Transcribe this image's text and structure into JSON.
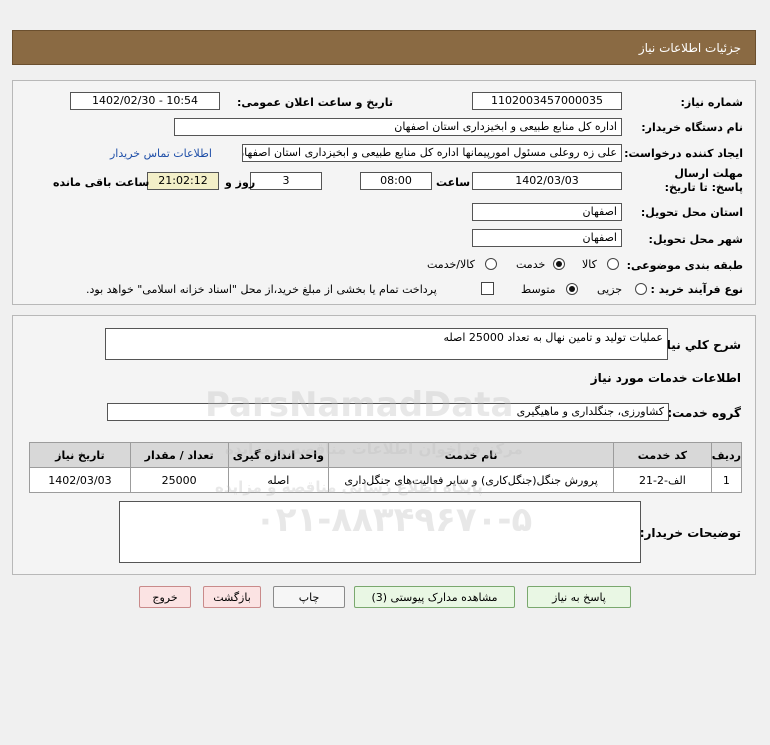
{
  "header": {
    "title": "جزئیات اطلاعات نیاز"
  },
  "labels": {
    "need_number": "شماره نیاز:",
    "announce_datetime": "تاریخ و ساعت اعلان عمومی:",
    "buyer_org": "نام دستگاه خریدار:",
    "requester": "ایجاد کننده درخواست:",
    "deadline": "مهلت ارسال پاسخ: تا تاریخ:",
    "time": "ساعت",
    "day_and": "روز و",
    "remaining": "ساعت باقی مانده",
    "province": "استان محل تحویل:",
    "city": "شهر محل تحویل:",
    "category": "طبقه بندی موضوعی:",
    "process_type": "نوع فرآیند خرید :",
    "general_desc": "شرح کلي نياز:",
    "services_info": "اطلاعات خدمات مورد نیاز",
    "service_group": "گروه خدمت:",
    "buyer_notes": "توضیحات خریدار:"
  },
  "values": {
    "need_number": "1102003457000035",
    "announce_datetime": "1402/02/30 - 10:54",
    "buyer_org": "اداره کل منابع طبیعی و ابخیزداری استان اصفهان",
    "requester": "علی زه روعلی مسئول امورپیمانها اداره کل منابع طبیعی و ابخیزداری استان اصفهان",
    "contact_link": "اطلاعات تماس خریدار",
    "deadline_date": "1402/03/03",
    "deadline_time": "08:00",
    "days": "3",
    "remaining_time": "21:02:12",
    "province": "اصفهان",
    "city": "اصفهان",
    "general_desc": "عملیات تولید و تامین نهال به تعداد 25000 اصله",
    "service_group": "کشاورزی، جنگلداری و ماهیگیری",
    "buyer_notes": ""
  },
  "category_options": [
    {
      "label": "کالا",
      "selected": false
    },
    {
      "label": "خدمت",
      "selected": true
    },
    {
      "label": "کالا/خدمت",
      "selected": false
    }
  ],
  "process_options": [
    {
      "label": "جزیی",
      "selected": false
    },
    {
      "label": "متوسط",
      "selected": true
    }
  ],
  "payment_note": "پرداخت تمام یا بخشی از مبلغ خرید،از محل \"اسناد خزانه اسلامی\" خواهد بود.",
  "table": {
    "headers": [
      "ردیف",
      "کد خدمت",
      "نام خدمت",
      "واحد اندازه گیری",
      "تعداد / مقدار",
      "تاریخ نیاز"
    ],
    "rows": [
      [
        "1",
        "الف-2-21",
        "پرورش جنگل(جنگل‌کاری) و سایر فعالیت‌های جنگل‌داری",
        "اصله",
        "25000",
        "1402/03/03"
      ]
    ]
  },
  "buttons": {
    "reply": "پاسخ به نیاز",
    "view_docs": "مشاهده مدارک پیوستی (3)",
    "print": "چاپ",
    "back": "بازگشت",
    "exit": "خروج"
  },
  "watermark": {
    "brand": "ParsNamadData",
    "line1": "مرکز فراخوان اطلاعات مناقصه و مزایده",
    "line2": "پایگاه اطلاع رسانی مناقصه و مزایده",
    "phone": "۰۲۱-۸۸۳۴۹۶۷۰-۵"
  }
}
